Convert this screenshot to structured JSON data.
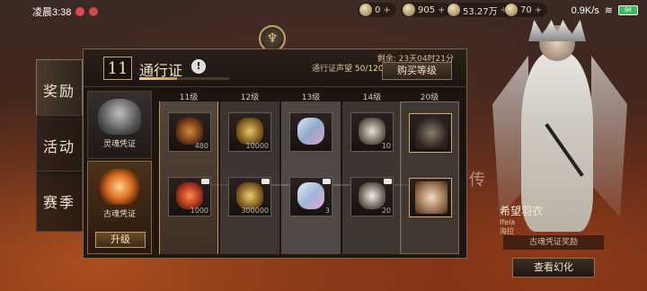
{
  "status": {
    "time": "凌晨3:38",
    "net": "0.9K/s",
    "battery": "84"
  },
  "resources": [
    {
      "name": "currency-1",
      "value": "0"
    },
    {
      "name": "currency-2",
      "value": "905"
    },
    {
      "name": "currency-3",
      "value": "53.27万"
    },
    {
      "name": "currency-4",
      "value": "70"
    }
  ],
  "tabs": [
    "奖励",
    "活动",
    "赛季"
  ],
  "pass": {
    "level": "11",
    "title": "通行证",
    "remaining": "剩余: 23天04时21分",
    "prestige_label": "通行证声望",
    "prestige_value": "50/120",
    "prestige_fraction": 0.42,
    "buy_label": "购买等级",
    "free_pass": "灵魂凭证",
    "premium_pass": "古魂凭证",
    "upgrade_label": "升级"
  },
  "levels": [
    "11级",
    "12级",
    "13级",
    "14级",
    "20级"
  ],
  "rewards_top": [
    {
      "qty": "480",
      "icon": "ember-gear-icon"
    },
    {
      "qty": "10000",
      "icon": "gold-ore-icon"
    },
    {
      "qty": "",
      "icon": "crystal-shard-icon"
    },
    {
      "qty": "10",
      "icon": "mask-icon"
    },
    {
      "qty": "",
      "icon": "warrior-portrait-icon"
    }
  ],
  "rewards_bottom": [
    {
      "qty": "1000",
      "icon": "fire-crystal-icon"
    },
    {
      "qty": "300000",
      "icon": "gold-ore-icon"
    },
    {
      "qty": "3",
      "icon": "crystal-shard-icon"
    },
    {
      "qty": "20",
      "icon": "mask-icon"
    },
    {
      "qty": "",
      "icon": "angel-portrait-icon"
    }
  ],
  "character": {
    "name": "希望羽衣",
    "sub": "Ifela",
    "sub2": "海拉",
    "reward_tag": "古魂凭证奖励",
    "view_button": "查看幻化"
  }
}
